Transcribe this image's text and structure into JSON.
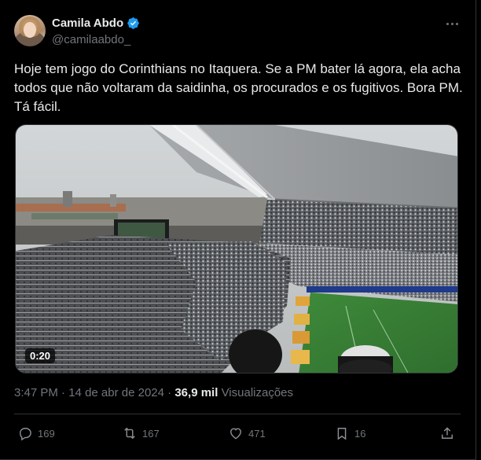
{
  "author": {
    "name": "Camila Abdo",
    "handle": "@camilaabdo_"
  },
  "tweet": {
    "text": "Hoje tem jogo do Corinthians no Itaquera. Se a PM bater lá agora, ela acha todos que não voltaram da saidinha, os procurados e os fugitivos. Bora PM. Tá fácil."
  },
  "media": {
    "duration": "0:20"
  },
  "meta": {
    "time": "3:47 PM",
    "separator": "·",
    "date": "14 de abr de 2024",
    "views_count": "36,9 mil",
    "views_label": "Visualizações"
  },
  "actions": {
    "replies": "169",
    "reposts": "167",
    "likes": "471",
    "bookmarks": "16"
  },
  "colors": {
    "background": "#000000",
    "text": "#e7e9ea",
    "muted": "#71767b",
    "verified": "#1d9bf0",
    "border": "#2f3336"
  }
}
